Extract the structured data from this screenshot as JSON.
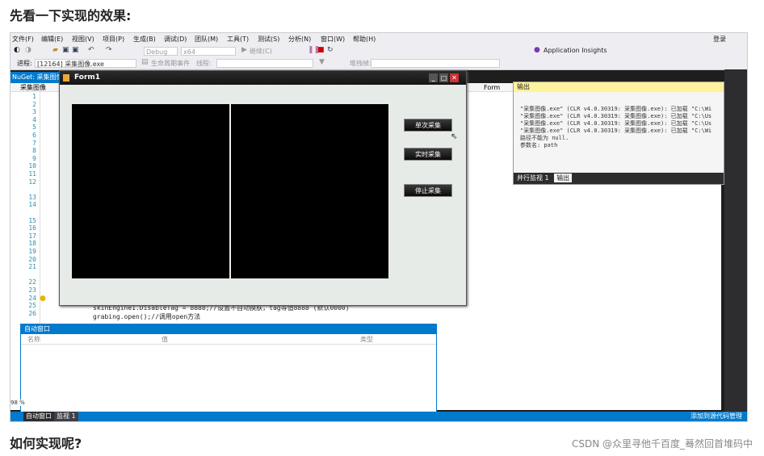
{
  "article": {
    "heading_top": "先看一下实现的效果:",
    "heading_bottom": "如何实现呢?",
    "watermark": "CSDN @众里寻他千百度_蓦然回首堆码中"
  },
  "vs": {
    "menu": [
      "文件(F)",
      "编辑(E)",
      "视图(V)",
      "项目(P)",
      "生成(B)",
      "调试(D)",
      "团队(M)",
      "工具(T)",
      "测试(S)",
      "分析(N)",
      "窗口(W)",
      "帮助(H)"
    ],
    "login": "登录",
    "toolbar": {
      "config": "Debug",
      "platform": "x64",
      "continue_label": "继续(C)",
      "insights": "Application Insights"
    },
    "toolbar2": {
      "process_label": "进程:",
      "process_value": "[12164] 采集图像.exe",
      "lifecycle_label": "生命周期事件",
      "thread_label": "线程:",
      "stack_label": "堆栈帧:"
    },
    "nuget_tab": "NuGet: 采集图像",
    "file_tab": "采集图像",
    "form_nav": "Form",
    "line_numbers": [
      "1",
      "2",
      "3",
      "4",
      "5",
      "6",
      "7",
      "8",
      "9",
      "10",
      "11",
      "12",
      "13",
      "14",
      "15",
      "16",
      "17",
      "18",
      "19",
      "20",
      "21",
      "22",
      "23",
      "24",
      "25",
      "26"
    ],
    "code_lines": [
      "skinEngine1.DisableTag = 8888;//设置不自动换肤，tag等值8888 (默认0000)",
      "grabing.open();//调用open方法"
    ],
    "form1": {
      "title": "Form1",
      "buttons": [
        "单次采集",
        "实时采集",
        "停止采集"
      ]
    },
    "output": {
      "title": "输出",
      "lines": [
        "\"采集图像.exe\" (CLR v4.0.30319: 采集图像.exe): 已加载 \"C:\\Wi",
        "\"采集图像.exe\" (CLR v4.0.30319: 采集图像.exe): 已加载 \"C:\\Us",
        "\"采集图像.exe\" (CLR v4.0.30319: 采集图像.exe): 已加载 \"C:\\Us",
        "\"采集图像.exe\" (CLR v4.0.30319: 采集图像.exe): 已加载 \"C:\\Wi",
        "路径不能为 null.",
        "参数名: path"
      ],
      "tabs": [
        "并行监视 1",
        "输出"
      ]
    },
    "autos": {
      "title": "自动窗口",
      "columns": [
        "名称",
        "值",
        "类型"
      ]
    },
    "zoom": "98 %",
    "status": {
      "tabs": [
        "自动窗口",
        "监视 1"
      ],
      "right": "添加到源代码管理"
    }
  }
}
